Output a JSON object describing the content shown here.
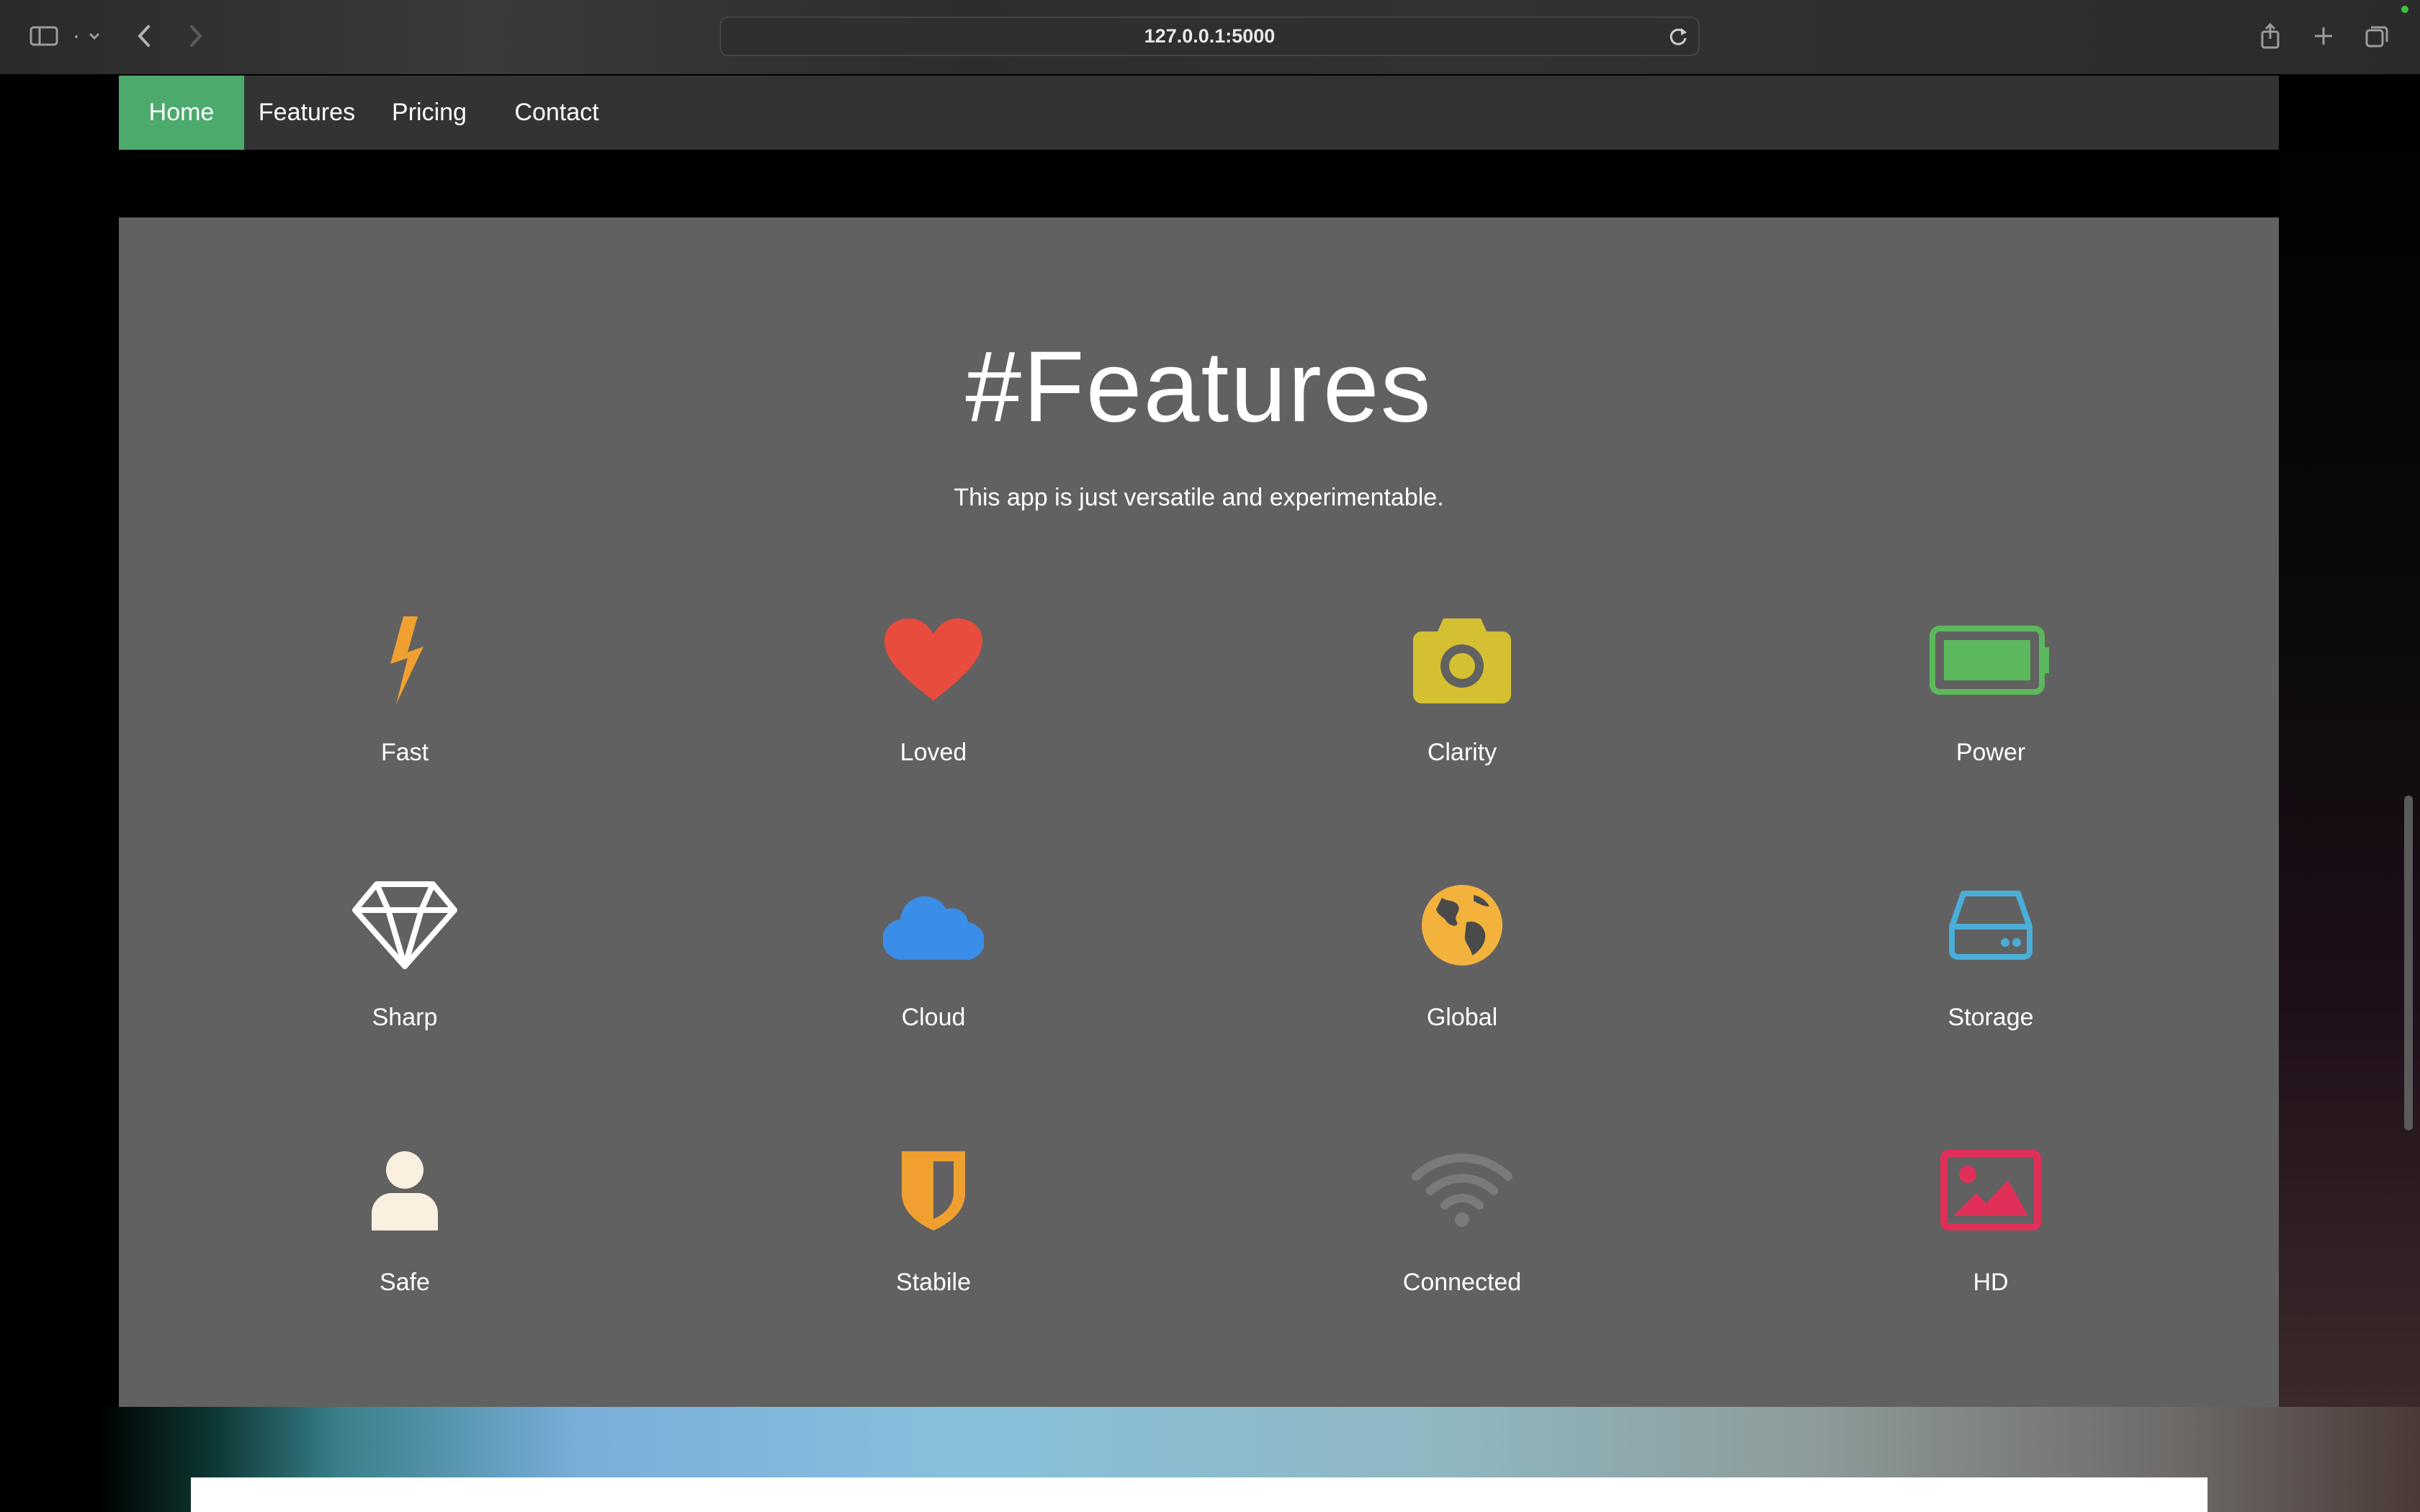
{
  "browser": {
    "url": "127.0.0.1:5000",
    "tab_group_label": "·"
  },
  "nav": {
    "items": [
      {
        "label": "Home",
        "active": true
      },
      {
        "label": "Features",
        "active": false
      },
      {
        "label": "Pricing",
        "active": false
      },
      {
        "label": "Contact",
        "active": false
      }
    ]
  },
  "features_section": {
    "title": "#Features",
    "subtitle": "This app is just versatile and experimentable.",
    "items": [
      {
        "label": "Fast",
        "icon": "bolt-icon",
        "color": "#f0a030"
      },
      {
        "label": "Loved",
        "icon": "heart-icon",
        "color": "#e84c3d"
      },
      {
        "label": "Clarity",
        "icon": "camera-icon",
        "color": "#d4c030"
      },
      {
        "label": "Power",
        "icon": "battery-icon",
        "color": "#5cb85c"
      },
      {
        "label": "Sharp",
        "icon": "diamond-icon",
        "color": "#ffffff"
      },
      {
        "label": "Cloud",
        "icon": "cloud-icon",
        "color": "#3b8ee8"
      },
      {
        "label": "Global",
        "icon": "globe-icon",
        "color": "#f2b23c"
      },
      {
        "label": "Storage",
        "icon": "hard-drive-icon",
        "color": "#4aaed8"
      },
      {
        "label": "Safe",
        "icon": "user-icon",
        "color": "#faf0e0"
      },
      {
        "label": "Stabile",
        "icon": "shield-icon",
        "color": "#f0a030"
      },
      {
        "label": "Connected",
        "icon": "wifi-icon",
        "color": "#7a7a7a"
      },
      {
        "label": "HD",
        "icon": "image-icon",
        "color": "#e0305a"
      }
    ]
  }
}
